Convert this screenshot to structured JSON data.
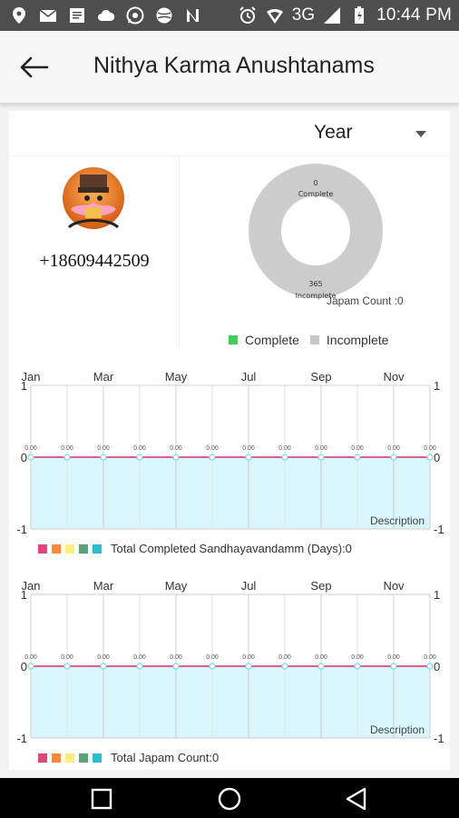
{
  "status_bar": {
    "time": "10:44 PM",
    "network": "3G",
    "icons": [
      "location-pin-icon",
      "email-icon",
      "news-icon",
      "cloud-icon",
      "whatsapp-icon",
      "ball-icon",
      "n-icon",
      "alarm-icon",
      "wifi-icon",
      "signal-icon",
      "battery-icon"
    ]
  },
  "app_bar": {
    "title": "Nithya Karma Anushtanams",
    "back_icon": "arrow-back-icon"
  },
  "filter": {
    "selected_period": "Year"
  },
  "profile": {
    "phone": "+18609442509"
  },
  "donut": {
    "complete_value": "0",
    "complete_label": "Complete",
    "incomplete_value": "365",
    "incomplete_label": "Incomplete",
    "japam_count": "Japam Count :0",
    "legend": [
      {
        "label": "Complete",
        "color": "#44cc55"
      },
      {
        "label": "Incomplete",
        "color": "#c8c8c8"
      }
    ],
    "ring_color": "#cdcdcd"
  },
  "charts": [
    {
      "chart_data": {
        "type": "line",
        "x_tick_labels": [
          "Jan",
          "Mar",
          "May",
          "Jul",
          "Sep",
          "Nov"
        ],
        "y_ticks": [
          "1",
          "0",
          "-1"
        ],
        "ylim": [
          -1,
          1
        ],
        "values": [
          0,
          0,
          0,
          0,
          0,
          0,
          0,
          0,
          0,
          0,
          0,
          0
        ],
        "point_labels": [
          "0.00",
          "0.00",
          "0.00",
          "0.00",
          "0.00",
          "0.00",
          "0.00",
          "0.00",
          "0.00",
          "0.00",
          "0.00",
          "0.00"
        ],
        "description": "Description",
        "grid": true,
        "fill_color": "#d9f6fc",
        "line_color": "#e0608a"
      },
      "legend_colors": [
        "#e0457b",
        "#fe8a35",
        "#f8f07a",
        "#5aa37a",
        "#2dbbd0"
      ],
      "legend_text": "Total Completed Sandhayavandamm (Days):0"
    },
    {
      "chart_data": {
        "type": "line",
        "x_tick_labels": [
          "Jan",
          "Mar",
          "May",
          "Jul",
          "Sep",
          "Nov"
        ],
        "y_ticks": [
          "1",
          "0",
          "-1"
        ],
        "ylim": [
          -1,
          1
        ],
        "values": [
          0,
          0,
          0,
          0,
          0,
          0,
          0,
          0,
          0,
          0,
          0,
          0
        ],
        "point_labels": [
          "0.00",
          "0.00",
          "0.00",
          "0.00",
          "0.00",
          "0.00",
          "0.00",
          "0.00",
          "0.00",
          "0.00",
          "0.00",
          "0.00"
        ],
        "description": "Description",
        "grid": true,
        "fill_color": "#d9f6fc",
        "line_color": "#e0608a"
      },
      "legend_colors": [
        "#e0457b",
        "#fe8a35",
        "#f8f07a",
        "#5aa37a",
        "#2dbbd0"
      ],
      "legend_text": "Total Japam Count:0"
    }
  ]
}
